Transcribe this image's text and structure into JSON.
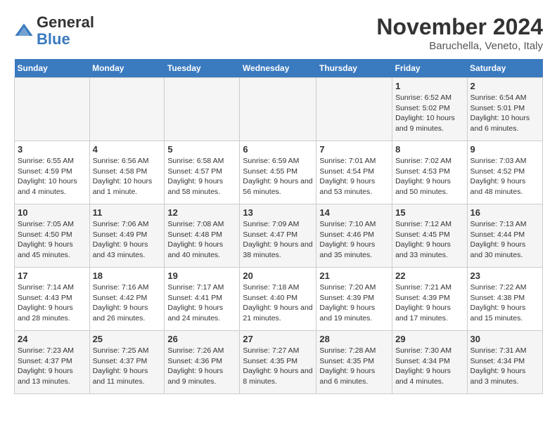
{
  "logo": {
    "general": "General",
    "blue": "Blue"
  },
  "header": {
    "month": "November 2024",
    "location": "Baruchella, Veneto, Italy"
  },
  "weekdays": [
    "Sunday",
    "Monday",
    "Tuesday",
    "Wednesday",
    "Thursday",
    "Friday",
    "Saturday"
  ],
  "weeks": [
    [
      {
        "day": "",
        "info": ""
      },
      {
        "day": "",
        "info": ""
      },
      {
        "day": "",
        "info": ""
      },
      {
        "day": "",
        "info": ""
      },
      {
        "day": "",
        "info": ""
      },
      {
        "day": "1",
        "info": "Sunrise: 6:52 AM\nSunset: 5:02 PM\nDaylight: 10 hours and 9 minutes."
      },
      {
        "day": "2",
        "info": "Sunrise: 6:54 AM\nSunset: 5:01 PM\nDaylight: 10 hours and 6 minutes."
      }
    ],
    [
      {
        "day": "3",
        "info": "Sunrise: 6:55 AM\nSunset: 4:59 PM\nDaylight: 10 hours and 4 minutes."
      },
      {
        "day": "4",
        "info": "Sunrise: 6:56 AM\nSunset: 4:58 PM\nDaylight: 10 hours and 1 minute."
      },
      {
        "day": "5",
        "info": "Sunrise: 6:58 AM\nSunset: 4:57 PM\nDaylight: 9 hours and 58 minutes."
      },
      {
        "day": "6",
        "info": "Sunrise: 6:59 AM\nSunset: 4:55 PM\nDaylight: 9 hours and 56 minutes."
      },
      {
        "day": "7",
        "info": "Sunrise: 7:01 AM\nSunset: 4:54 PM\nDaylight: 9 hours and 53 minutes."
      },
      {
        "day": "8",
        "info": "Sunrise: 7:02 AM\nSunset: 4:53 PM\nDaylight: 9 hours and 50 minutes."
      },
      {
        "day": "9",
        "info": "Sunrise: 7:03 AM\nSunset: 4:52 PM\nDaylight: 9 hours and 48 minutes."
      }
    ],
    [
      {
        "day": "10",
        "info": "Sunrise: 7:05 AM\nSunset: 4:50 PM\nDaylight: 9 hours and 45 minutes."
      },
      {
        "day": "11",
        "info": "Sunrise: 7:06 AM\nSunset: 4:49 PM\nDaylight: 9 hours and 43 minutes."
      },
      {
        "day": "12",
        "info": "Sunrise: 7:08 AM\nSunset: 4:48 PM\nDaylight: 9 hours and 40 minutes."
      },
      {
        "day": "13",
        "info": "Sunrise: 7:09 AM\nSunset: 4:47 PM\nDaylight: 9 hours and 38 minutes."
      },
      {
        "day": "14",
        "info": "Sunrise: 7:10 AM\nSunset: 4:46 PM\nDaylight: 9 hours and 35 minutes."
      },
      {
        "day": "15",
        "info": "Sunrise: 7:12 AM\nSunset: 4:45 PM\nDaylight: 9 hours and 33 minutes."
      },
      {
        "day": "16",
        "info": "Sunrise: 7:13 AM\nSunset: 4:44 PM\nDaylight: 9 hours and 30 minutes."
      }
    ],
    [
      {
        "day": "17",
        "info": "Sunrise: 7:14 AM\nSunset: 4:43 PM\nDaylight: 9 hours and 28 minutes."
      },
      {
        "day": "18",
        "info": "Sunrise: 7:16 AM\nSunset: 4:42 PM\nDaylight: 9 hours and 26 minutes."
      },
      {
        "day": "19",
        "info": "Sunrise: 7:17 AM\nSunset: 4:41 PM\nDaylight: 9 hours and 24 minutes."
      },
      {
        "day": "20",
        "info": "Sunrise: 7:18 AM\nSunset: 4:40 PM\nDaylight: 9 hours and 21 minutes."
      },
      {
        "day": "21",
        "info": "Sunrise: 7:20 AM\nSunset: 4:39 PM\nDaylight: 9 hours and 19 minutes."
      },
      {
        "day": "22",
        "info": "Sunrise: 7:21 AM\nSunset: 4:39 PM\nDaylight: 9 hours and 17 minutes."
      },
      {
        "day": "23",
        "info": "Sunrise: 7:22 AM\nSunset: 4:38 PM\nDaylight: 9 hours and 15 minutes."
      }
    ],
    [
      {
        "day": "24",
        "info": "Sunrise: 7:23 AM\nSunset: 4:37 PM\nDaylight: 9 hours and 13 minutes."
      },
      {
        "day": "25",
        "info": "Sunrise: 7:25 AM\nSunset: 4:37 PM\nDaylight: 9 hours and 11 minutes."
      },
      {
        "day": "26",
        "info": "Sunrise: 7:26 AM\nSunset: 4:36 PM\nDaylight: 9 hours and 9 minutes."
      },
      {
        "day": "27",
        "info": "Sunrise: 7:27 AM\nSunset: 4:35 PM\nDaylight: 9 hours and 8 minutes."
      },
      {
        "day": "28",
        "info": "Sunrise: 7:28 AM\nSunset: 4:35 PM\nDaylight: 9 hours and 6 minutes."
      },
      {
        "day": "29",
        "info": "Sunrise: 7:30 AM\nSunset: 4:34 PM\nDaylight: 9 hours and 4 minutes."
      },
      {
        "day": "30",
        "info": "Sunrise: 7:31 AM\nSunset: 4:34 PM\nDaylight: 9 hours and 3 minutes."
      }
    ]
  ]
}
